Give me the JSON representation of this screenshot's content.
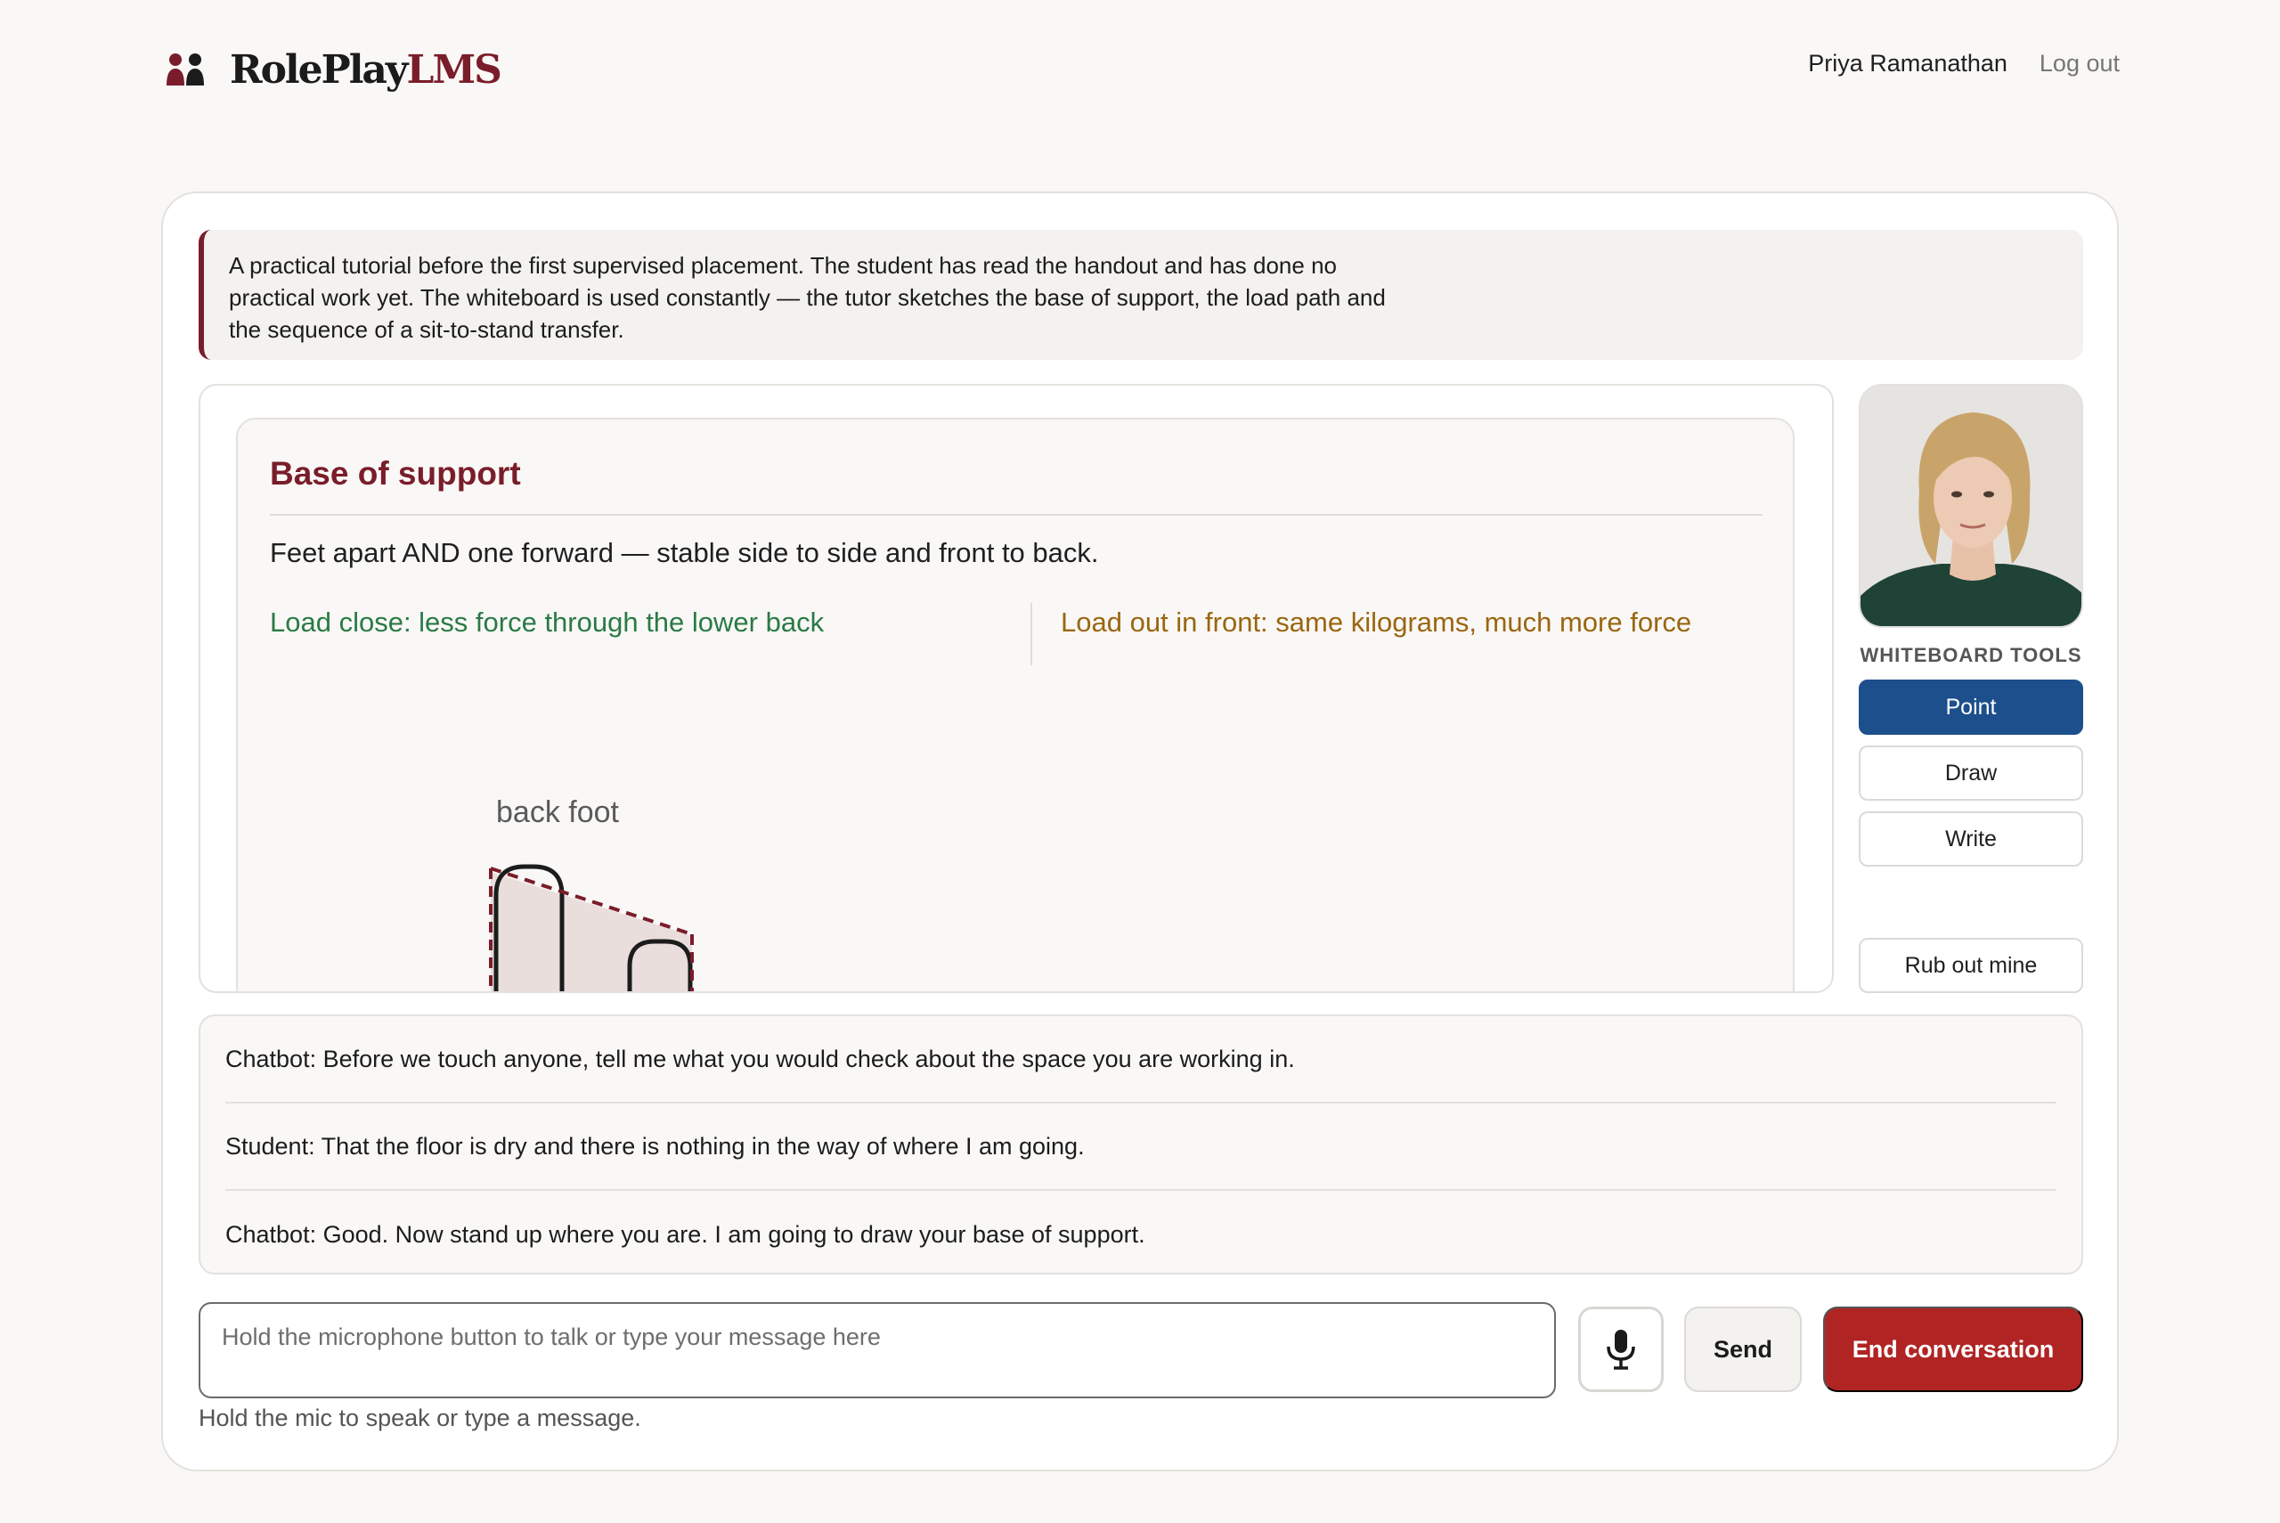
{
  "brand": {
    "name_main": "RolePlay",
    "name_accent": "LMS",
    "logo_icon": "two-people-icon"
  },
  "user": {
    "name": "Priya Ramanathan",
    "logout_label": "Log out"
  },
  "scenario": {
    "text": "A practical tutorial before the first supervised placement. The student has read the handout and has done no practical work yet. The whiteboard is used constantly — the tutor sketches the base of support, the load path and the sequence of a sit-to-stand transfer."
  },
  "whiteboard": {
    "title": "Base of support",
    "subtitle": "Feet apart AND one forward — stable side to side and front to back.",
    "left_note": "Load close: less force through the lower back",
    "right_note": "Load out in front: same kilograms, much more force",
    "figure_label": "back foot"
  },
  "tools": {
    "heading": "WHITEBOARD TOOLS",
    "point": "Point",
    "draw": "Draw",
    "write": "Write",
    "rub_out": "Rub out mine",
    "active": "Point"
  },
  "transcript": [
    {
      "text": "Chatbot: Before we touch anyone, tell me what you would check about the space you are working in."
    },
    {
      "text": "Student: That the floor is dry and there is nothing in the way of where I am going."
    },
    {
      "text": "Chatbot: Good. Now stand up where you are. I am going to draw your base of support."
    }
  ],
  "composer": {
    "placeholder": "Hold the microphone button to talk or type your message here",
    "value": "",
    "mic_icon": "microphone-icon",
    "send_label": "Send",
    "end_label": "End conversation",
    "hint": "Hold the mic to speak or type a message."
  },
  "colors": {
    "brand_accent": "#7a1d2a",
    "active_tool": "#1d4f8c",
    "end_button": "#b02424",
    "note_green": "#2a7a46",
    "note_amber": "#9a6610"
  }
}
